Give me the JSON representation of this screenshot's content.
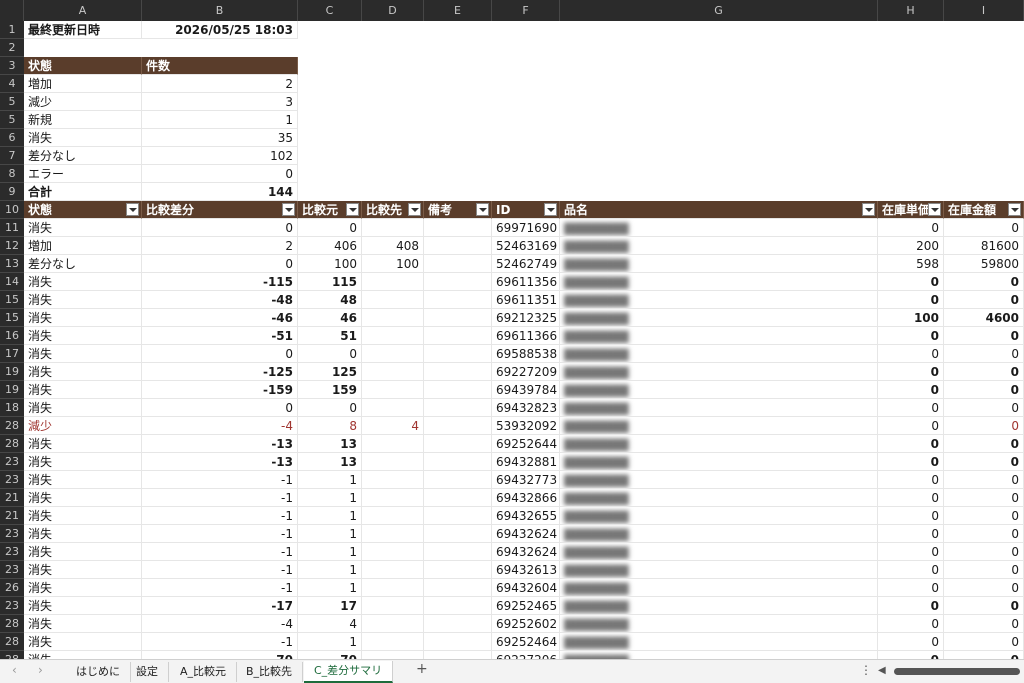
{
  "columns": [
    "A",
    "B",
    "C",
    "D",
    "E",
    "F",
    "G",
    "H",
    "I"
  ],
  "summary": {
    "last_updated_label": "最終更新日時",
    "last_updated_value": "2026/05/25 18:03",
    "header": [
      "状態",
      "件数"
    ],
    "rows": [
      [
        "増加",
        "2"
      ],
      [
        "減少",
        "3"
      ],
      [
        "新規",
        "1"
      ],
      [
        "消失",
        "35"
      ],
      [
        "差分なし",
        "102"
      ],
      [
        "エラー",
        "0"
      ]
    ],
    "total": [
      "合計",
      "144"
    ]
  },
  "table": {
    "headers": [
      "状態",
      "比較差分",
      "比較元",
      "比較先",
      "備考",
      "ID",
      "品名",
      "在庫単価",
      "在庫金額"
    ],
    "rows": [
      {
        "rn": "11",
        "v": [
          "消失",
          "0",
          "0",
          "",
          "",
          "69971690",
          "",
          "0",
          "0"
        ],
        "bold": false,
        "red": false
      },
      {
        "rn": "12",
        "v": [
          "増加",
          "2",
          "406",
          "408",
          "",
          "52463169",
          "",
          "200",
          "81600"
        ],
        "bold": false,
        "red": false
      },
      {
        "rn": "13",
        "v": [
          "差分なし",
          "0",
          "100",
          "100",
          "",
          "52462749",
          "",
          "598",
          "59800"
        ],
        "bold": false,
        "red": false
      },
      {
        "rn": "14",
        "v": [
          "消失",
          "-115",
          "115",
          "",
          "",
          "69611356",
          "",
          "0",
          "0"
        ],
        "bold": true,
        "red": false
      },
      {
        "rn": "15",
        "v": [
          "消失",
          "-48",
          "48",
          "",
          "",
          "69611351",
          "",
          "0",
          "0"
        ],
        "bold": true,
        "red": false
      },
      {
        "rn": "15",
        "v": [
          "消失",
          "-46",
          "46",
          "",
          "",
          "69212325",
          "",
          "100",
          "4600"
        ],
        "bold": true,
        "red": false
      },
      {
        "rn": "16",
        "v": [
          "消失",
          "-51",
          "51",
          "",
          "",
          "69611366",
          "",
          "0",
          "0"
        ],
        "bold": true,
        "red": false
      },
      {
        "rn": "17",
        "v": [
          "消失",
          "0",
          "0",
          "",
          "",
          "69588538",
          "",
          "0",
          "0"
        ],
        "bold": false,
        "red": false
      },
      {
        "rn": "19",
        "v": [
          "消失",
          "-125",
          "125",
          "",
          "",
          "69227209",
          "",
          "0",
          "0"
        ],
        "bold": true,
        "red": false
      },
      {
        "rn": "19",
        "v": [
          "消失",
          "-159",
          "159",
          "",
          "",
          "69439784",
          "",
          "0",
          "0"
        ],
        "bold": true,
        "red": false
      },
      {
        "rn": "18",
        "v": [
          "消失",
          "0",
          "0",
          "",
          "",
          "69432823",
          "",
          "0",
          "0"
        ],
        "bold": false,
        "red": false
      },
      {
        "rn": "28",
        "v": [
          "減少",
          "-4",
          "8",
          "4",
          "",
          "53932092",
          "",
          "0",
          "0"
        ],
        "bold": false,
        "red": true
      },
      {
        "rn": "28",
        "v": [
          "消失",
          "-13",
          "13",
          "",
          "",
          "69252644",
          "",
          "0",
          "0"
        ],
        "bold": true,
        "red": false
      },
      {
        "rn": "23",
        "v": [
          "消失",
          "-13",
          "13",
          "",
          "",
          "69432881",
          "",
          "0",
          "0"
        ],
        "bold": true,
        "red": false
      },
      {
        "rn": "23",
        "v": [
          "消失",
          "-1",
          "1",
          "",
          "",
          "69432773",
          "",
          "0",
          "0"
        ],
        "bold": false,
        "red": false
      },
      {
        "rn": "21",
        "v": [
          "消失",
          "-1",
          "1",
          "",
          "",
          "69432866",
          "",
          "0",
          "0"
        ],
        "bold": false,
        "red": false
      },
      {
        "rn": "21",
        "v": [
          "消失",
          "-1",
          "1",
          "",
          "",
          "69432655",
          "",
          "0",
          "0"
        ],
        "bold": false,
        "red": false
      },
      {
        "rn": "23",
        "v": [
          "消失",
          "-1",
          "1",
          "",
          "",
          "69432624",
          "",
          "0",
          "0"
        ],
        "bold": false,
        "red": false
      },
      {
        "rn": "23",
        "v": [
          "消失",
          "-1",
          "1",
          "",
          "",
          "69432624",
          "",
          "0",
          "0"
        ],
        "bold": false,
        "red": false
      },
      {
        "rn": "23",
        "v": [
          "消失",
          "-1",
          "1",
          "",
          "",
          "69432613",
          "",
          "0",
          "0"
        ],
        "bold": false,
        "red": false
      },
      {
        "rn": "26",
        "v": [
          "消失",
          "-1",
          "1",
          "",
          "",
          "69432604",
          "",
          "0",
          "0"
        ],
        "bold": false,
        "red": false
      },
      {
        "rn": "23",
        "v": [
          "消失",
          "-17",
          "17",
          "",
          "",
          "69252465",
          "",
          "0",
          "0"
        ],
        "bold": true,
        "red": false
      },
      {
        "rn": "28",
        "v": [
          "消失",
          "-4",
          "4",
          "",
          "",
          "69252602",
          "",
          "0",
          "0"
        ],
        "bold": false,
        "red": false
      },
      {
        "rn": "28",
        "v": [
          "消失",
          "-1",
          "1",
          "",
          "",
          "69252464",
          "",
          "0",
          "0"
        ],
        "bold": false,
        "red": false
      },
      {
        "rn": "28",
        "v": [
          "消失",
          "-70",
          "70",
          "",
          "",
          "69227206",
          "",
          "0",
          "0"
        ],
        "bold": true,
        "red": false
      }
    ]
  },
  "sheet_tabs": [
    "はじめに",
    "設定",
    "A_比較元",
    "B_比較先",
    "C_差分サマリ"
  ],
  "active_tab": "C_差分サマリ",
  "add_sheet_label": "+",
  "colors": {
    "header_bg": "#5a3d2b",
    "row_header_bg": "#2b2b2b",
    "decrease": "#a03530",
    "active_tab": "#1e6b3c"
  }
}
